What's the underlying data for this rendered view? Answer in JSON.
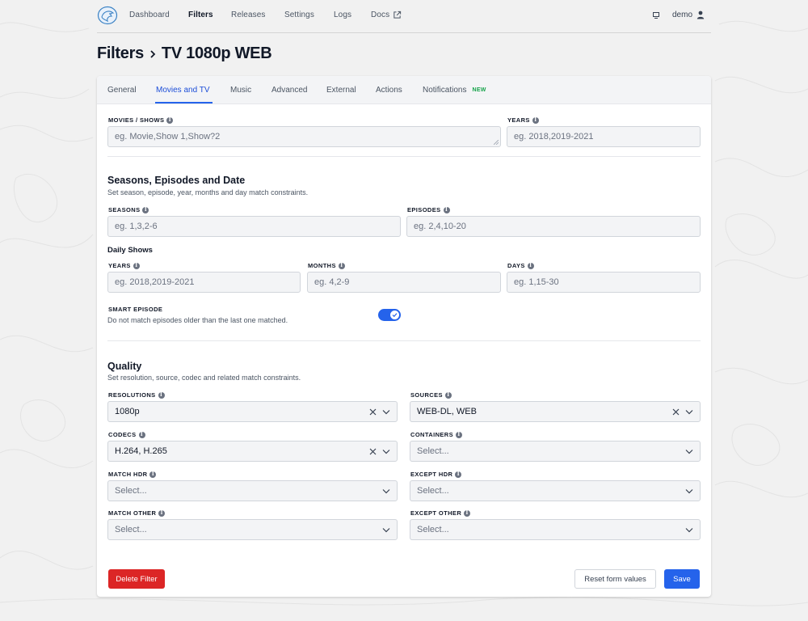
{
  "nav": {
    "items": [
      "Dashboard",
      "Filters",
      "Releases",
      "Settings",
      "Logs",
      "Docs"
    ],
    "active": "Filters",
    "user": "demo"
  },
  "breadcrumb": {
    "parent": "Filters",
    "current": "TV 1080p WEB"
  },
  "tabs": {
    "items": [
      "General",
      "Movies and TV",
      "Music",
      "Advanced",
      "External",
      "Actions",
      "Notifications"
    ],
    "active": "Movies and TV",
    "new_badge": "NEW"
  },
  "movies": {
    "shows_label": "MOVIES / SHOWS",
    "shows_placeholder": "eg. Movie,Show 1,Show?2",
    "years_label": "YEARS",
    "years_placeholder": "eg. 2018,2019-2021"
  },
  "seasons_section": {
    "title": "Seasons, Episodes and Date",
    "subtitle": "Set season, episode, year, months and day match constraints.",
    "seasons_label": "SEASONS",
    "seasons_placeholder": "eg. 1,3,2-6",
    "episodes_label": "EPISODES",
    "episodes_placeholder": "eg. 2,4,10-20",
    "daily_heading": "Daily Shows",
    "years_label": "YEARS",
    "years_placeholder": "eg. 2018,2019-2021",
    "months_label": "MONTHS",
    "months_placeholder": "eg. 4,2-9",
    "days_label": "DAYS",
    "days_placeholder": "eg. 1,15-30",
    "smart_label": "SMART EPISODE",
    "smart_desc": "Do not match episodes older than the last one matched.",
    "smart_enabled": true
  },
  "quality": {
    "title": "Quality",
    "subtitle": "Set resolution, source, codec and related match constraints.",
    "resolutions_label": "RESOLUTIONS",
    "resolutions_value": "1080p",
    "sources_label": "SOURCES",
    "sources_value": "WEB-DL, WEB",
    "codecs_label": "CODECS",
    "codecs_value": "H.264, H.265",
    "containers_label": "CONTAINERS",
    "containers_value": "Select...",
    "match_hdr_label": "MATCH HDR",
    "match_hdr_value": "Select...",
    "except_hdr_label": "EXCEPT HDR",
    "except_hdr_value": "Select...",
    "match_other_label": "MATCH OTHER",
    "match_other_value": "Select...",
    "except_other_label": "EXCEPT OTHER",
    "except_other_value": "Select..."
  },
  "footer": {
    "delete": "Delete Filter",
    "reset": "Reset form values",
    "save": "Save"
  },
  "colors": {
    "accent": "#2563eb",
    "danger": "#dc2626",
    "new_badge": "#16a34a"
  }
}
